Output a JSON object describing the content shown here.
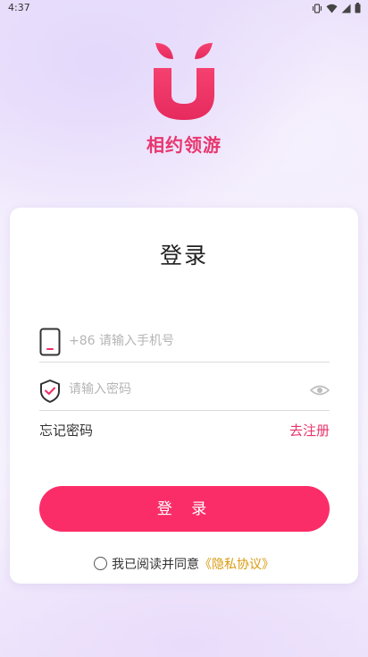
{
  "status_bar": {
    "time": "4:37",
    "icons": [
      "vibrate-icon",
      "wifi-icon",
      "signal-icon",
      "battery-icon"
    ]
  },
  "app": {
    "name": "相约领游",
    "logo": "app-logo-u-icon",
    "brand_color": "#e8366e"
  },
  "login": {
    "title": "登录",
    "phone_placeholder": "+86 请输入手机号",
    "phone_value": "",
    "password_placeholder": "请输入密码",
    "password_value": "",
    "forgot_password": "忘记密码",
    "register": "去注册",
    "submit": "登 录",
    "agreement_text": "我已阅读并同意",
    "agreement_link": "《隐私协议》",
    "agreement_checked": false
  },
  "colors": {
    "accent": "#fb2d68",
    "link": "#e8336b",
    "agreement_link": "#d99a10"
  }
}
